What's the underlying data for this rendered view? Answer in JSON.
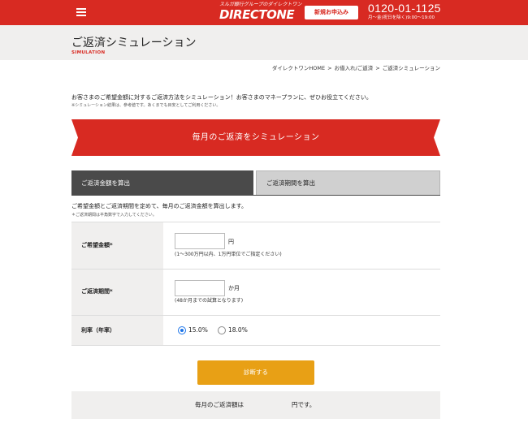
{
  "header": {
    "logo_tagline": "スルガ銀行グループのダイレクトワン",
    "logo_name": "DIRECTONE",
    "apply_button": "新規お申込み",
    "phone_number": "0120-01-1125",
    "phone_hours": "月〜金(祝日を除く)9:00〜19:00",
    "brand_color": "#d82a22"
  },
  "page": {
    "title": "ご返済シミュレーション",
    "title_en": "SIMULATION"
  },
  "breadcrumb": {
    "items": [
      "ダイレクトワンHOME",
      "お借入れ/ご返済",
      "ご返済シミュレーション"
    ],
    "separator": ">"
  },
  "intro": {
    "text": "お客さまのご希望金額に対するご返済方法をシミュレーション！お客さまのマネープランに、ぜひお役立てください。",
    "note": "※シミュレーション結果は、参考値です。あくまでも目安としてご利用ください。"
  },
  "banner": {
    "title": "毎月のご返済をシミュレーション"
  },
  "tabs": [
    {
      "label": "ご返済金額を算出",
      "active": true
    },
    {
      "label": "ご返済期間を算出",
      "active": false
    }
  ],
  "form": {
    "description": "ご希望金額とご返済期間を定めて、毎月のご返済金額を算出します。",
    "note": "＊ご返済期間は半角数字で入力してください。",
    "amount": {
      "label": "ご希望金額*",
      "value": "",
      "unit": "円",
      "hint": "(1〜300万円以内、1万円単位でご指定ください)"
    },
    "period": {
      "label": "ご返済期間*",
      "value": "",
      "unit": "か月",
      "hint": "(48か月までの試算となります)"
    },
    "rate": {
      "label": "利率（年率）",
      "options": [
        {
          "label": "15.0%",
          "checked": true
        },
        {
          "label": "18.0%",
          "checked": false
        }
      ]
    },
    "submit_label": "診断する",
    "submit_color": "#e8a015"
  },
  "result": {
    "prefix": "毎月のご返済額は",
    "value": "",
    "suffix": "円です。"
  }
}
